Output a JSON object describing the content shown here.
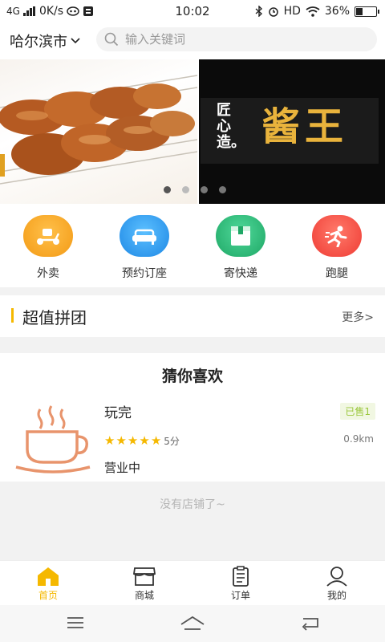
{
  "status": {
    "network": "4G",
    "speed": "0K/s",
    "time": "10:02",
    "right_icons": [
      "bluetooth-icon",
      "alarm-icon",
      "wifi-icon"
    ],
    "hd": "HD",
    "battery": "36%",
    "battery_level": 0.36
  },
  "header": {
    "city": "哈尔滨市",
    "search_placeholder": "输入关键词"
  },
  "banner": {
    "slide2_small": "匠心造。",
    "slide2_big": "酱王",
    "slides_count": 4,
    "active_index": 0
  },
  "categories": [
    {
      "label": "外卖",
      "icon": "scooter-icon",
      "color": "#f5a623"
    },
    {
      "label": "预约订座",
      "icon": "sofa-icon",
      "color": "#2f9bf0"
    },
    {
      "label": "寄快递",
      "icon": "package-icon",
      "color": "#2dbd78"
    },
    {
      "label": "跑腿",
      "icon": "runner-icon",
      "color": "#f0483e"
    }
  ],
  "group_buy": {
    "title": "超值拼团",
    "more": "更多>"
  },
  "guess": {
    "title": "猜你喜欢",
    "store": {
      "name": "玩完",
      "sold": "已售1",
      "rating": 5,
      "score": "5分",
      "distance": "0.9km",
      "status": "营业中"
    }
  },
  "empty_text": "没有店铺了~",
  "tabs": [
    {
      "label": "首页",
      "icon": "home-icon",
      "active": true
    },
    {
      "label": "商城",
      "icon": "shop-icon",
      "active": false
    },
    {
      "label": "订单",
      "icon": "order-icon",
      "active": false
    },
    {
      "label": "我的",
      "icon": "user-icon",
      "active": false
    }
  ],
  "colors": {
    "accent": "#f5b800",
    "sold_green": "#9ac73b"
  }
}
